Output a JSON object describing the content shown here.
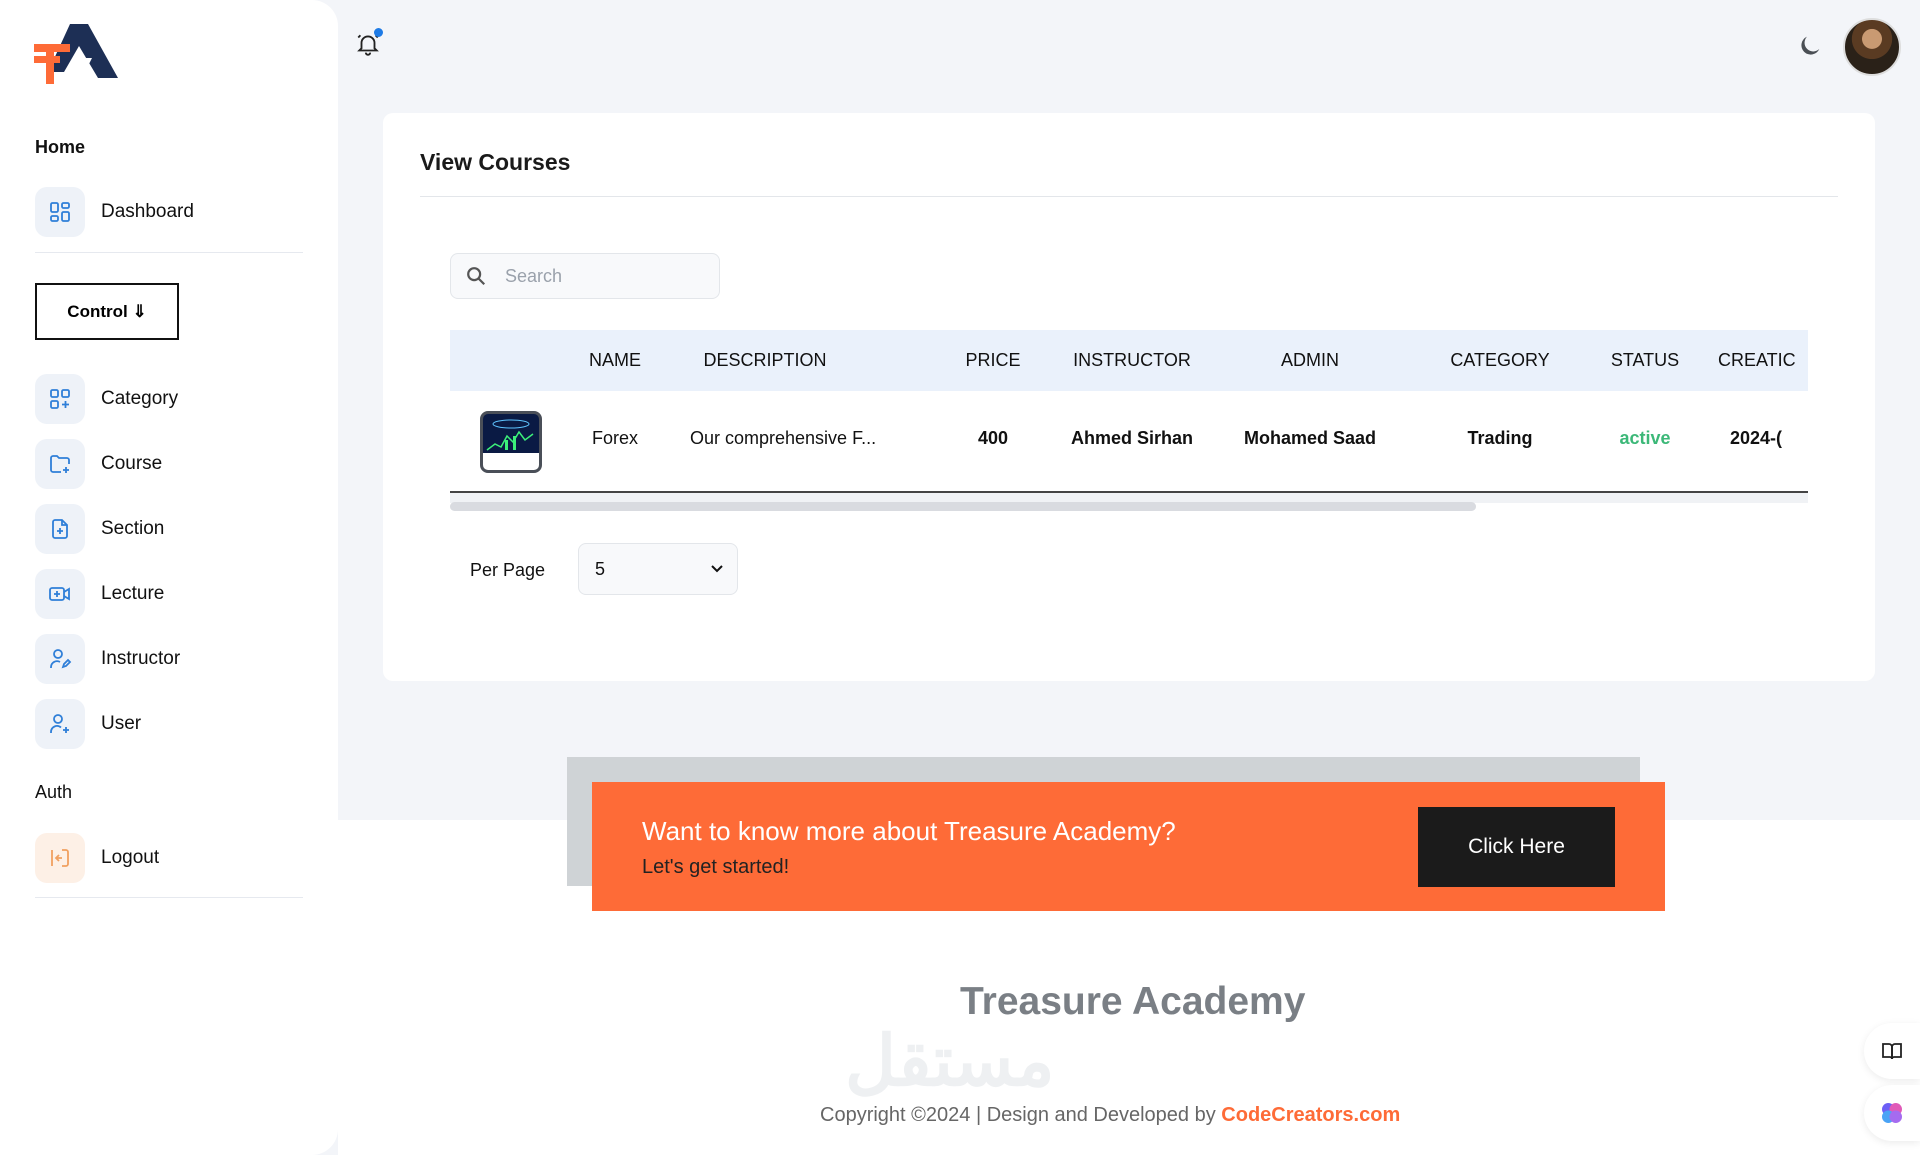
{
  "sidebar": {
    "home_heading": "Home",
    "dashboard": "Dashboard",
    "control_button": "Control ⇓",
    "items": [
      {
        "label": "Category",
        "icon": "grid-plus-icon"
      },
      {
        "label": "Course",
        "icon": "folder-plus-icon"
      },
      {
        "label": "Section",
        "icon": "file-plus-icon"
      },
      {
        "label": "Lecture",
        "icon": "video-plus-icon"
      },
      {
        "label": "Instructor",
        "icon": "user-edit-icon"
      },
      {
        "label": "User",
        "icon": "user-plus-icon"
      }
    ],
    "auth_heading": "Auth",
    "logout": "Logout"
  },
  "card": {
    "title": "View Courses",
    "search_placeholder": "Search",
    "columns": [
      "NAME",
      "DESCRIPTION",
      "PRICE",
      "INSTRUCTOR",
      "ADMIN",
      "CATEGORY",
      "STATUS",
      "CREATIC"
    ],
    "rows": [
      {
        "name": "Forex",
        "description": "Our comprehensive F...",
        "price": "400",
        "instructor": "Ahmed Sirhan",
        "admin": "Mohamed Saad",
        "category": "Trading",
        "status": "active",
        "created": "2024-("
      }
    ],
    "per_page_label": "Per Page",
    "per_page_value": "5"
  },
  "banner": {
    "title": "Want to know more about Treasure Academy?",
    "subtitle": "Let's get started!",
    "button": "Click Here"
  },
  "footer": {
    "brand": "Treasure Academy",
    "watermark": "مستقل",
    "copyright": "Copyright ©2024 | Design and Developed by ",
    "link": "CodeCreators.com"
  },
  "colors": {
    "accent_orange": "#fe6b37",
    "status_active": "#3cb878",
    "notification_dot": "#1e7be6",
    "header_bg": "#eaf1fb"
  }
}
